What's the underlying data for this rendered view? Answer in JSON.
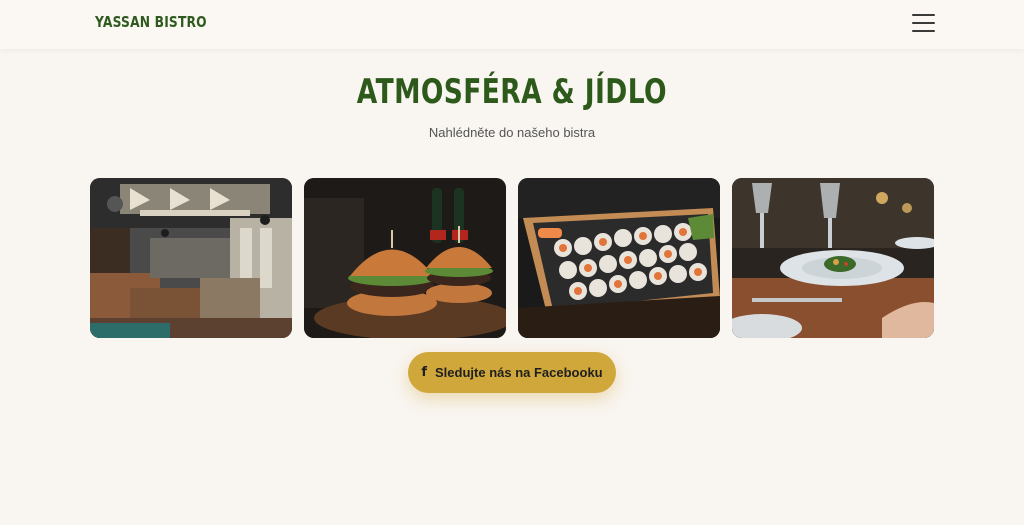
{
  "header": {
    "brand": "YASSAN BISTRO",
    "menu_icon": "hamburger-menu-icon"
  },
  "section": {
    "title": "ATMOSFÉRA & JÍDLO",
    "subtitle": "Nahlédněte do našeho bistra"
  },
  "gallery": {
    "photos": [
      {
        "subject": "bistro-interior"
      },
      {
        "subject": "burgers"
      },
      {
        "subject": "sushi-boat"
      },
      {
        "subject": "fine-dining-plate"
      }
    ]
  },
  "cta": {
    "label": "Sledujte nás na Facebooku",
    "icon": "facebook-icon",
    "color": "#d0a73b"
  },
  "colors": {
    "brand_green": "#2d5a1b",
    "background": "#f9f5f0",
    "accent_gold": "#d0a73b"
  }
}
